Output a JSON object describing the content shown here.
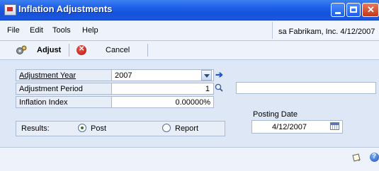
{
  "window": {
    "title": "Inflation Adjustments",
    "accent_color": "#1d5ee8"
  },
  "menu": {
    "file": "File",
    "edit": "Edit",
    "tools": "Tools",
    "help": "Help"
  },
  "user_info": "sa  Fabrikam, Inc.  4/12/2007",
  "toolbar": {
    "adjust": "Adjust",
    "cancel": "Cancel"
  },
  "form": {
    "adjustment_year_label": "Adjustment Year",
    "adjustment_year_value": "2007",
    "adjustment_period_label": "Adjustment Period",
    "adjustment_period_value": "1",
    "inflation_index_label": "Inflation Index",
    "inflation_index_value": "0.00000%",
    "period_description_value": "",
    "posting_date_label": "Posting Date",
    "posting_date_value": "4/12/2007",
    "results_label": "Results:",
    "results_options": [
      "Post",
      "Report"
    ],
    "results_selected": "Post"
  },
  "icons": {
    "adjust": "gears-icon",
    "cancel": "cancel-icon",
    "lookup": "magnifier-icon",
    "expand": "arrow-right-icon",
    "calendar": "calendar-icon",
    "note": "note-icon",
    "help": "help-icon"
  }
}
